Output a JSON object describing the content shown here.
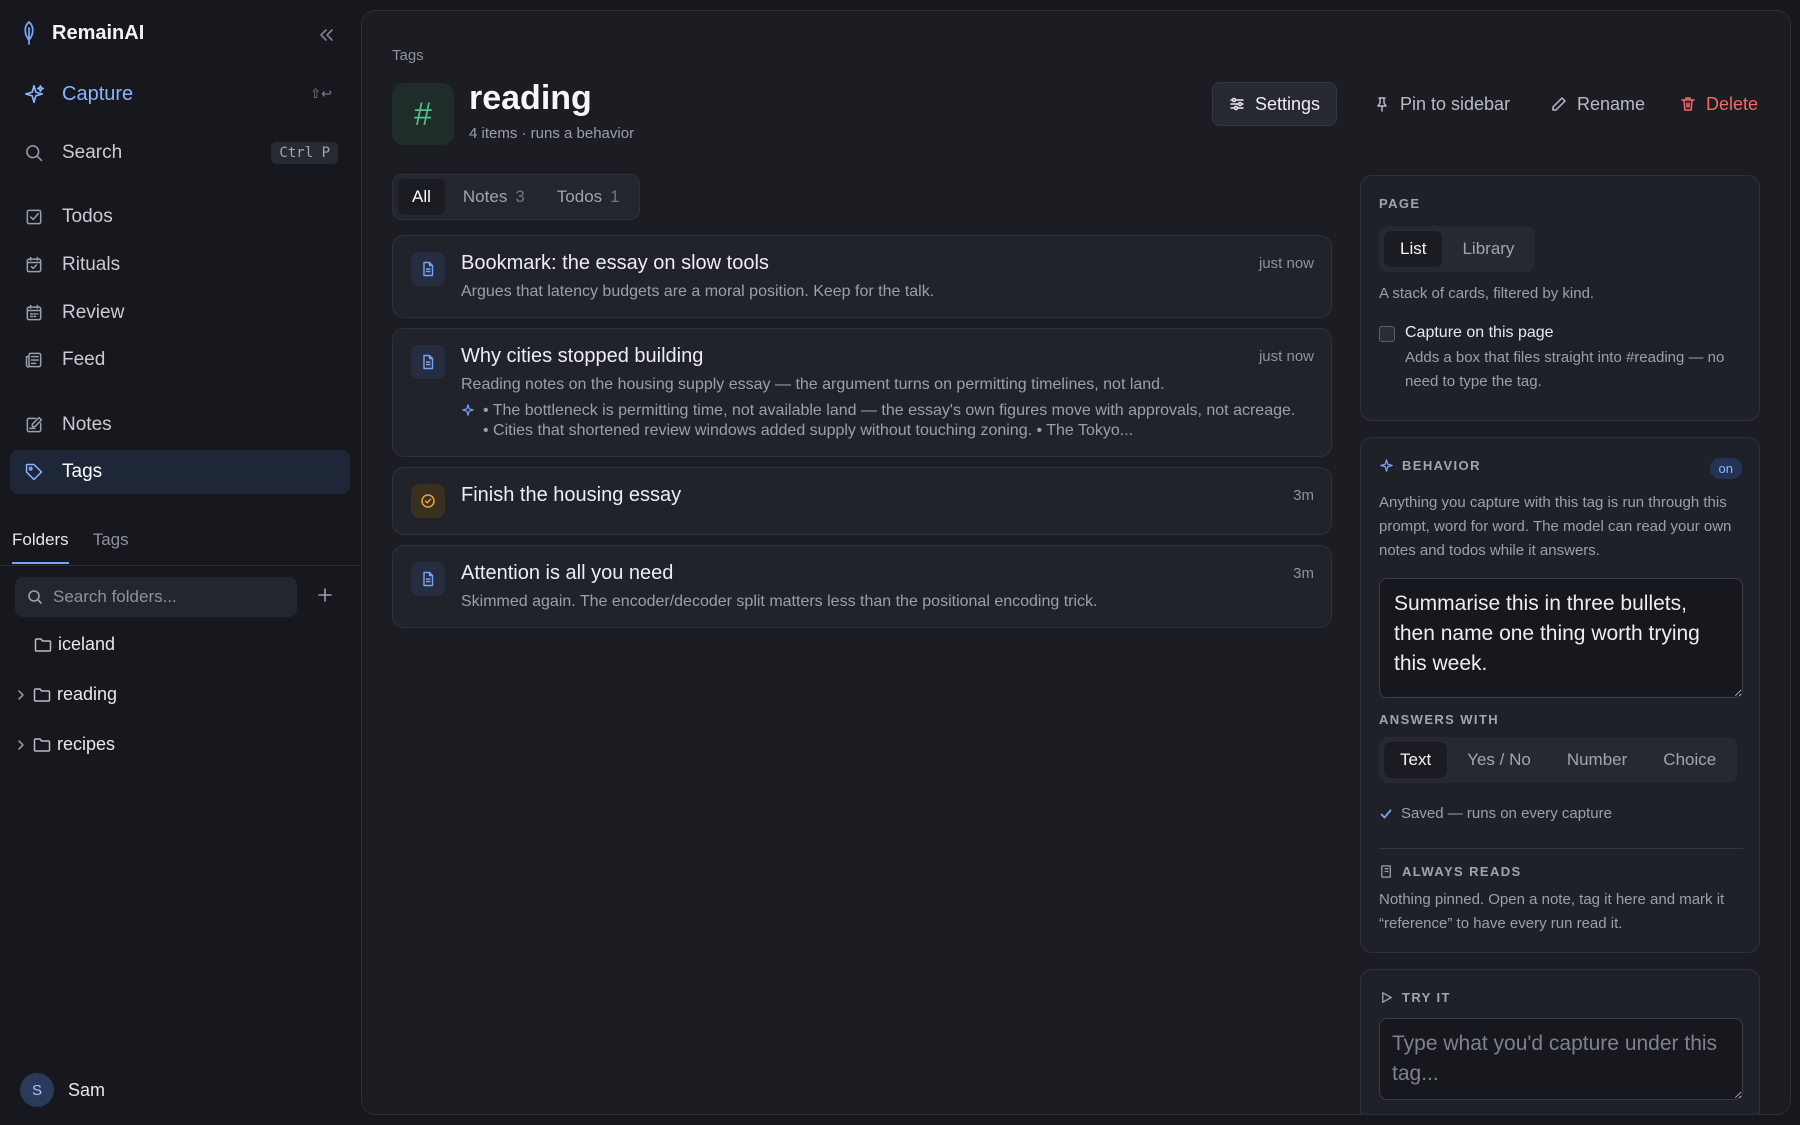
{
  "app": {
    "name": "RemainAI"
  },
  "sidebar": {
    "capture": {
      "label": "Capture",
      "shortcut": "⇧↩"
    },
    "search": {
      "label": "Search",
      "shortcut": "Ctrl P"
    },
    "nav": [
      {
        "label": "Todos",
        "icon": "checkbox-icon"
      },
      {
        "label": "Rituals",
        "icon": "calendar-check-icon"
      },
      {
        "label": "Review",
        "icon": "calendar-icon"
      },
      {
        "label": "Feed",
        "icon": "newspaper-icon"
      },
      {
        "label": "Notes",
        "icon": "note-edit-icon"
      },
      {
        "label": "Tags",
        "icon": "tag-icon",
        "active": true
      }
    ],
    "tabs": {
      "folders": "Folders",
      "tags": "Tags"
    },
    "folder_search_placeholder": "Search folders...",
    "folders": [
      {
        "name": "iceland",
        "expandable": false
      },
      {
        "name": "reading",
        "expandable": true
      },
      {
        "name": "recipes",
        "expandable": true
      }
    ],
    "user": {
      "initial": "S",
      "name": "Sam"
    }
  },
  "header": {
    "breadcrumb": "Tags",
    "tag_symbol": "#",
    "title": "reading",
    "subtitle": "4 items · runs a behavior",
    "buttons": {
      "settings": "Settings",
      "pin": "Pin to sidebar",
      "rename": "Rename",
      "delete": "Delete"
    }
  },
  "filters": {
    "all": "All",
    "notes": {
      "label": "Notes",
      "count": "3"
    },
    "todos": {
      "label": "Todos",
      "count": "1"
    }
  },
  "items": [
    {
      "type": "note",
      "title": "Bookmark: the essay on slow tools",
      "time": "just now",
      "body": "Argues that latency budgets are a moral position. Keep for the talk."
    },
    {
      "type": "note",
      "title": "Why cities stopped building",
      "time": "just now",
      "body": "Reading notes on the housing supply essay — the argument turns on permitting timelines, not land.",
      "ai": "• The bottleneck is permitting time, not available land — the essay's own figures move with approvals, not acreage. • Cities that shortened review windows added supply without touching zoning. • The Tokyo..."
    },
    {
      "type": "todo",
      "title": "Finish the housing essay",
      "time": "3m"
    },
    {
      "type": "note",
      "title": "Attention is all you need",
      "time": "3m",
      "body": "Skimmed again. The encoder/decoder split matters less than the positional encoding trick."
    }
  ],
  "panel": {
    "page": {
      "heading": "PAGE",
      "views": [
        "List",
        "Library"
      ],
      "active_view": "List",
      "description": "A stack of cards, filtered by kind.",
      "capture_label": "Capture on this page",
      "capture_checked": false,
      "capture_desc": "Adds a box that files straight into #reading — no need to type the tag."
    },
    "behavior": {
      "heading": "BEHAVIOR",
      "status": "on",
      "description": "Anything you capture with this tag is run through this prompt, word for word. The model can read your own notes and todos while it answers.",
      "prompt": "Summarise this in three bullets, then name one thing worth trying this week.",
      "answers_heading": "ANSWERS WITH",
      "answer_types": [
        "Text",
        "Yes / No",
        "Number",
        "Choice"
      ],
      "active_answer": "Text",
      "saved": "Saved — runs on every capture",
      "reads_heading": "ALWAYS READS",
      "reads_desc": "Nothing pinned. Open a note, tag it here and mark it “reference” to have every run read it."
    },
    "try": {
      "heading": "TRY IT",
      "placeholder": "Type what you'd capture under this tag..."
    }
  }
}
